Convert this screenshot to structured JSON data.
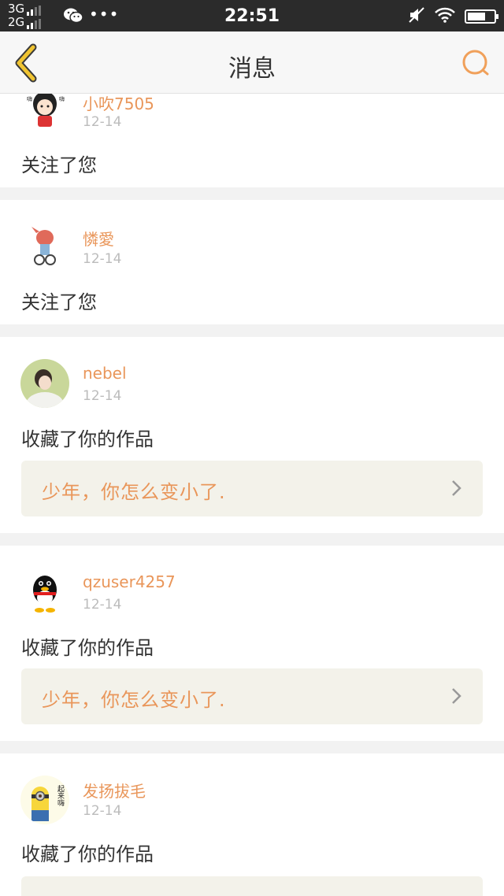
{
  "status_bar": {
    "network_1": "3G",
    "network_2": "2G",
    "dots": "•••",
    "time": "22:51"
  },
  "nav": {
    "title": "消息"
  },
  "colors": {
    "accent": "#e9965a",
    "back_icon": "#f0c431",
    "search_icon": "#f0a05a"
  },
  "notifications": [
    {
      "username": "小吹7505",
      "date": "12-14",
      "action": "关注了您",
      "avatar_icon": "cartoon-avatar-icon"
    },
    {
      "username": "憐愛",
      "date": "12-14",
      "action": "关注了您",
      "avatar_icon": "cartoon-avatar-icon"
    },
    {
      "username": "nebel",
      "date": "12-14",
      "action": "收藏了你的作品",
      "work_title": "少年，你怎么变小了.",
      "avatar_icon": "photo-avatar-icon"
    },
    {
      "username": "qzuser4257",
      "date": "12-14",
      "action": "收藏了你的作品",
      "work_title": "少年，你怎么变小了.",
      "avatar_icon": "qq-penguin-avatar-icon"
    },
    {
      "username": "发扬拔毛",
      "date": "12-14",
      "action": "收藏了你的作品",
      "avatar_icon": "minion-avatar-icon",
      "avatar_text": "起来嗨"
    }
  ]
}
